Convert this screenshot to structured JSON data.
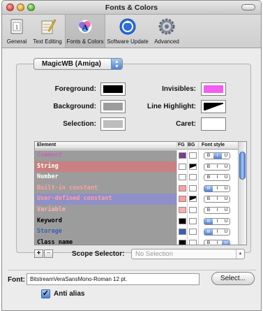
{
  "window": {
    "title": "Fonts & Colors"
  },
  "toolbar": {
    "items": [
      {
        "label": "General",
        "icon": "general-icon",
        "active": false
      },
      {
        "label": "Text Editing",
        "icon": "text-editing-icon",
        "active": false
      },
      {
        "label": "Fonts & Colors",
        "icon": "fonts-colors-icon",
        "active": true
      },
      {
        "label": "Software Update",
        "icon": "software-update-icon",
        "active": false
      },
      {
        "label": "Advanced",
        "icon": "gear-icon",
        "active": false
      }
    ]
  },
  "theme": {
    "selected": "MagicWB (Amiga)"
  },
  "colors": {
    "foreground": {
      "label": "Foreground:",
      "color": "#000000"
    },
    "background": {
      "label": "Background:",
      "color": "#9c9c9c"
    },
    "selection": {
      "label": "Selection:",
      "color": "#bdbdbd"
    },
    "invisibles": {
      "label": "Invisibles:",
      "color": "#f25ef2"
    },
    "line_highlight": {
      "label": "Line Highlight:",
      "color": "#000000"
    },
    "caret": {
      "label": "Caret:",
      "color": "#ffffff"
    }
  },
  "table": {
    "headers": {
      "element": "Element",
      "fg": "FG",
      "bg": "BG",
      "font_style": "Font style"
    },
    "style_buttons": [
      "B",
      "I",
      "U"
    ],
    "rows": [
      {
        "name": "Comment",
        "text_color": "#c06ab4",
        "row_bg": "#9c9c9c",
        "fg": "#7a3d8e",
        "bg": "#ffffff",
        "bold": false,
        "italic": true,
        "underline": false
      },
      {
        "name": "String",
        "text_color": "#ffffff",
        "row_bg": "#c98080",
        "fg": "#ffffff",
        "bg": "#000000",
        "bold": false,
        "italic": false,
        "underline": false
      },
      {
        "name": "Number",
        "text_color": "#ffffff",
        "row_bg": "#9c9c9c",
        "fg": "#ffffff",
        "bg": "#ffffff",
        "bold": false,
        "italic": false,
        "underline": false
      },
      {
        "name": "Built-in constant",
        "text_color": "#ffa0a0",
        "row_bg": "#9c9c9c",
        "fg": "#ffa0a0",
        "bg": "#ffffff",
        "bold": true,
        "italic": false,
        "underline": false
      },
      {
        "name": "User-defined constant",
        "text_color": "#ffa0a0",
        "row_bg": "#8f8fc9",
        "fg": "#ffa0a0",
        "bg": "#000000",
        "bold": false,
        "italic": false,
        "underline": false
      },
      {
        "name": "Variable",
        "text_color": "#ffb0b0",
        "row_bg": "#9c9c9c",
        "fg": "#ffb0b0",
        "bg": "#ffffff",
        "bold": false,
        "italic": false,
        "underline": false
      },
      {
        "name": "Keyword",
        "text_color": "#000000",
        "row_bg": "#9c9c9c",
        "fg": "#000000",
        "bg": "#ffffff",
        "bold": true,
        "italic": false,
        "underline": false
      },
      {
        "name": "Storage",
        "text_color": "#3a5fb0",
        "row_bg": "#9c9c9c",
        "fg": "#3a5fb0",
        "bg": "#ffffff",
        "bold": true,
        "italic": false,
        "underline": false
      },
      {
        "name": "Class name",
        "text_color": "#000000",
        "row_bg": "#9c9c9c",
        "fg": "#000000",
        "bg": "#ffffff",
        "bold": false,
        "italic": false,
        "underline": true
      }
    ]
  },
  "scope": {
    "add": "+",
    "remove": "−",
    "label": "Scope Selector:",
    "placeholder": "No Selection"
  },
  "font": {
    "label": "Font:",
    "value": "BitstreamVeraSansMono-Roman 12 pt.",
    "select_label": "Select..."
  },
  "antialias": {
    "label": "Anti alias",
    "checked": true
  }
}
